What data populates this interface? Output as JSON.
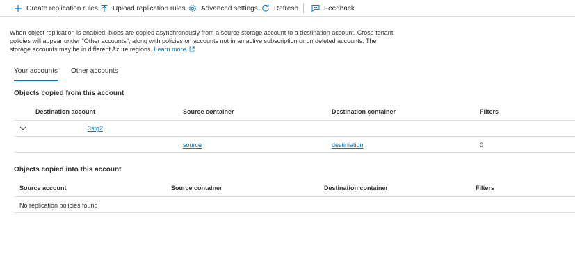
{
  "toolbar": {
    "create_label": "Create replication rules",
    "upload_label": "Upload replication rules",
    "advanced_label": "Advanced settings",
    "refresh_label": "Refresh",
    "feedback_label": "Feedback"
  },
  "description": {
    "text": "When object replication is enabled, blobs are copied asynchronously from a source storage account to a destination account. Cross-tenant policies will appear under \"Other accounts\", along with policies on accounts not in an active subscription or on deleted accounts. The storage accounts may be in different Azure regions.",
    "learn_more": "Learn more."
  },
  "tabs": [
    {
      "label": "Your accounts",
      "active": true
    },
    {
      "label": "Other accounts",
      "active": false
    }
  ],
  "copied_from": {
    "title": "Objects copied from this account",
    "headers": [
      "Destination account",
      "Source container",
      "Destination container",
      "Filters"
    ],
    "group_account": "3stg2",
    "rows": [
      {
        "source_container": "source",
        "destination_container": "destiniation",
        "filters": "0"
      }
    ]
  },
  "copied_into": {
    "title": "Objects copied into this account",
    "headers": [
      "Source account",
      "Source container",
      "Destination container",
      "Filters"
    ],
    "empty_text": "No replication policies found"
  },
  "colors": {
    "accent": "#0078d4",
    "text": "#323130",
    "divider": "#e1dfdd"
  },
  "icons": [
    "plus-icon",
    "upload-icon",
    "gear-icon",
    "refresh-icon",
    "feedback-icon",
    "external-link-icon",
    "chevron-down-icon"
  ]
}
